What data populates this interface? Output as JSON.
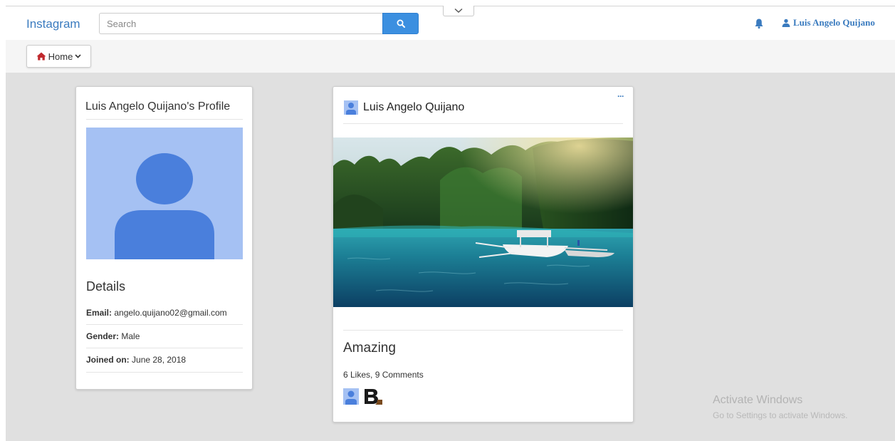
{
  "navbar": {
    "brand": "Instagram",
    "search_placeholder": "Search",
    "user_name": "Luis Angelo Quijano"
  },
  "subnav": {
    "home_label": "Home"
  },
  "profile": {
    "title": "Luis Angelo Quijano's Profile",
    "details_heading": "Details",
    "details": [
      {
        "label": "Email:",
        "value": "angelo.quijano02@gmail.com"
      },
      {
        "label": "Gender:",
        "value": "Male"
      },
      {
        "label": "Joined on:",
        "value": "June 28, 2018"
      }
    ]
  },
  "post": {
    "author": "Luis Angelo Quijano",
    "more_label": "···",
    "caption": "Amazing",
    "stats": "6 Likes, 9 Comments"
  },
  "watermark": {
    "title": "Activate Windows",
    "subtitle": "Go to Settings to activate Windows."
  },
  "colors": {
    "brand_blue": "#3a7bbf",
    "search_button": "#3b8fe0",
    "avatar_bg": "#a5c1f3",
    "avatar_fg": "#4a7fdc",
    "home_icon": "#c0282d",
    "content_bg": "#e0e0e0"
  },
  "icons": {
    "search": "search-icon",
    "collapse": "chevron-down-icon",
    "notifications": "bell-icon",
    "user": "user-icon",
    "home": "home-icon",
    "home_dropdown": "chevron-down-icon"
  }
}
